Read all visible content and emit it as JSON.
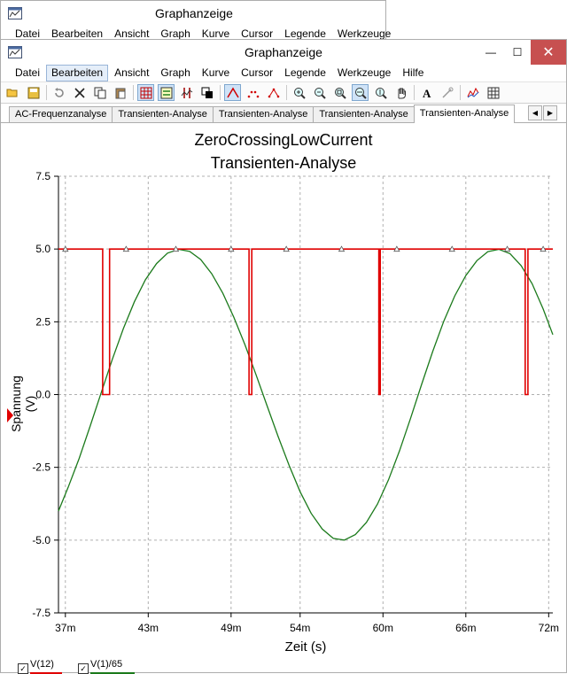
{
  "app": {
    "title": "Graphanzeige"
  },
  "menu": {
    "items": [
      "Datei",
      "Bearbeiten",
      "Ansicht",
      "Graph",
      "Kurve",
      "Cursor",
      "Legende",
      "Werkzeuge",
      "Hilfe"
    ],
    "active_index": 1
  },
  "back_menu": {
    "items": [
      "Datei",
      "Bearbeiten",
      "Ansicht",
      "Graph",
      "Kurve",
      "Cursor",
      "Legende",
      "Werkzeuge"
    ]
  },
  "window_buttons": {
    "minimize": "—",
    "maximize": "☐",
    "close": "✕"
  },
  "toolbar": {
    "icons": [
      "open-folder-icon",
      "save-icon",
      "undo-icon",
      "cut-icon",
      "copy-icon",
      "paste-icon",
      "grid-icon",
      "legend-icon",
      "cursors-icon",
      "overlay-icon",
      "curve-lines-icon",
      "curve-points-icon",
      "curve-lines-points-icon",
      "zoom-in-icon",
      "zoom-out-icon",
      "zoom-fit-icon",
      "zoom-x-icon",
      "zoom-y-icon",
      "pan-hand-icon",
      "text-icon",
      "properties-icon",
      "graph-export-icon",
      "table-icon"
    ],
    "pressed": [
      "grid-icon",
      "legend-icon",
      "curve-lines-icon",
      "zoom-x-icon"
    ]
  },
  "tabs": {
    "items": [
      "AC-Frequenzanalyse",
      "Transienten-Analyse",
      "Transienten-Analyse",
      "Transienten-Analyse",
      "Transienten-Analyse"
    ],
    "active_index": 4,
    "nav_prev": "◀",
    "nav_next": "▶"
  },
  "chart_data": {
    "type": "line",
    "title": "ZeroCrossingLowCurrent",
    "subtitle": "Transienten-Analyse",
    "xlabel": "Zeit (s)",
    "ylabel": "Spannung (V)",
    "xlim": [
      0.0365,
      0.0723
    ],
    "ylim": [
      -7.5,
      7.5
    ],
    "grid": true,
    "x_ticks": [
      {
        "value": 0.037,
        "label": "37m"
      },
      {
        "value": 0.043,
        "label": "43m"
      },
      {
        "value": 0.049,
        "label": "49m"
      },
      {
        "value": 0.054,
        "label": "54m"
      },
      {
        "value": 0.06,
        "label": "60m"
      },
      {
        "value": 0.066,
        "label": "66m"
      },
      {
        "value": 0.072,
        "label": "72m"
      }
    ],
    "y_ticks": [
      {
        "value": 7.5,
        "label": "7.5"
      },
      {
        "value": 5.0,
        "label": "5.0"
      },
      {
        "value": 2.5,
        "label": "2.5"
      },
      {
        "value": 0.0,
        "label": "0.0"
      },
      {
        "value": -2.5,
        "label": "-2.5"
      },
      {
        "value": -5.0,
        "label": "-5.0"
      },
      {
        "value": -7.5,
        "label": "-7.5"
      }
    ],
    "series": [
      {
        "name": "V(12)",
        "color": "#e00000",
        "marker": "triangle",
        "high": 5.0,
        "low": 0.0,
        "pulses": [
          [
            0.0397,
            0.0402
          ],
          [
            0.0503,
            0.0505
          ],
          [
            0.0597,
            0.0598
          ],
          [
            0.0703,
            0.0705
          ]
        ],
        "marker_x": [
          0.037,
          0.0414,
          0.045,
          0.049,
          0.053,
          0.057,
          0.061,
          0.065,
          0.069,
          0.0716
        ]
      },
      {
        "name": "V(1)/65",
        "color": "#1b7a1b",
        "x": [
          0.0365,
          0.0372,
          0.038,
          0.0388,
          0.0396,
          0.0404,
          0.0412,
          0.042,
          0.0428,
          0.0436,
          0.0444,
          0.0452,
          0.046,
          0.0468,
          0.0476,
          0.0484,
          0.0492,
          0.05,
          0.0508,
          0.0516,
          0.0524,
          0.0532,
          0.054,
          0.0548,
          0.0556,
          0.0564,
          0.0572,
          0.058,
          0.0588,
          0.0596,
          0.0604,
          0.0612,
          0.062,
          0.0628,
          0.0636,
          0.0644,
          0.0652,
          0.066,
          0.0668,
          0.0676,
          0.0684,
          0.0692,
          0.07,
          0.0708,
          0.0716,
          0.0723
        ],
        "y": [
          -4.0,
          -3.19,
          -2.19,
          -1.08,
          0.07,
          1.21,
          2.27,
          3.19,
          3.95,
          4.5,
          4.86,
          4.99,
          4.92,
          4.64,
          4.15,
          3.48,
          2.66,
          1.72,
          0.69,
          -0.38,
          -1.43,
          -2.43,
          -3.34,
          -4.08,
          -4.62,
          -4.94,
          -5.0,
          -4.81,
          -4.39,
          -3.76,
          -2.93,
          -1.93,
          -0.81,
          0.35,
          1.48,
          2.52,
          3.39,
          4.09,
          4.6,
          4.91,
          4.99,
          4.84,
          4.43,
          3.81,
          2.94,
          2.06
        ]
      }
    ]
  },
  "legend": {
    "items": [
      {
        "label": "V(12)",
        "color": "#e00000",
        "checked": true
      },
      {
        "label": "V(1)/65",
        "color": "#1b7a1b",
        "checked": true
      }
    ],
    "check_glyph": "✓"
  }
}
